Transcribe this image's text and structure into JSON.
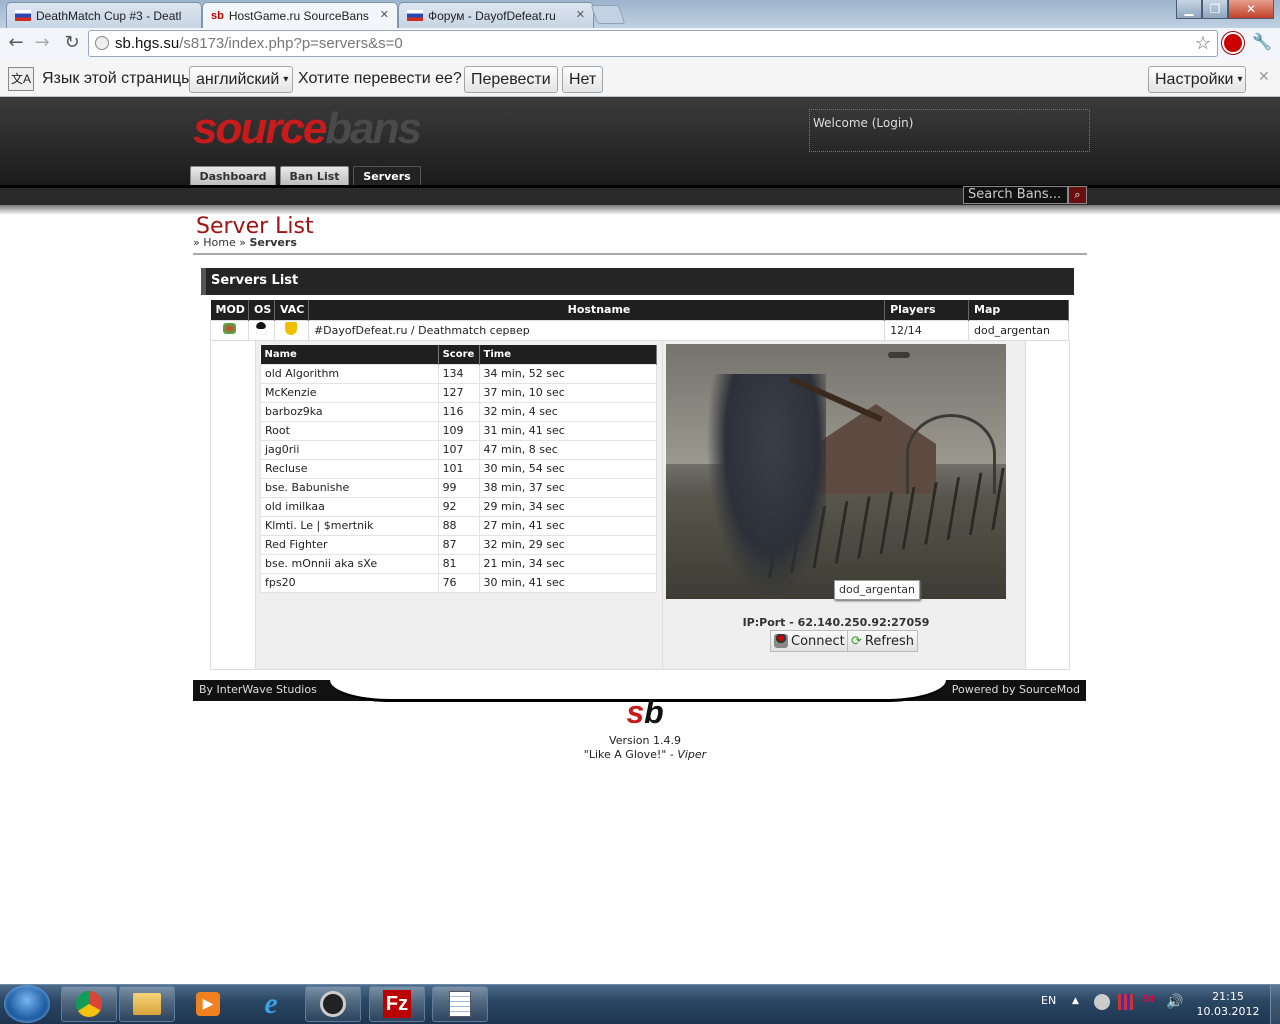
{
  "browser": {
    "tabs": [
      {
        "title": "DeathMatch Cup #3 - Deatl"
      },
      {
        "title": "HostGame.ru SourceBans"
      },
      {
        "title": "Форум - DayofDefeat.ru"
      }
    ],
    "url_host": "sb.hgs.su",
    "url_path": "/s8173/index.php?p=servers&s=0",
    "translate": {
      "prompt": "Язык этой страницы",
      "language": "английский",
      "question": "Хотите перевести ее?",
      "translate_btn": "Перевести",
      "no_btn": "Нет",
      "settings_btn": "Настройки"
    }
  },
  "site": {
    "logo_part1": "source",
    "logo_part2": "bans",
    "welcome_prefix": "Welcome (",
    "login": "Login",
    "welcome_suffix": ")",
    "nav": [
      "Dashboard",
      "Ban List",
      "Servers"
    ],
    "search_placeholder": "Search Bans..."
  },
  "page": {
    "title": "Server List",
    "breadcrumb_sep": "»",
    "breadcrumb_home": "Home",
    "breadcrumb_current": "Servers",
    "box_title": "Servers List"
  },
  "servers": {
    "headers": [
      "MOD",
      "OS",
      "VAC",
      "Hostname",
      "Players",
      "Map"
    ],
    "rows": [
      {
        "hostname": "#DayofDefeat.ru / Deathmatch сервер",
        "players": "12/14",
        "map": "dod_argentan"
      }
    ]
  },
  "players": {
    "headers": [
      "Name",
      "Score",
      "Time"
    ],
    "rows": [
      [
        "old Algorithm",
        "134",
        "34 min, 52 sec"
      ],
      [
        "McKenzie",
        "127",
        "37 min, 10 sec"
      ],
      [
        "barboz9ka",
        "116",
        "32 min, 4 sec"
      ],
      [
        "Root",
        "109",
        "31 min, 41 sec"
      ],
      [
        "jag0rii",
        "107",
        "47 min, 8 sec"
      ],
      [
        "Recluse",
        "101",
        "30 min, 54 sec"
      ],
      [
        "bse. Babunishe",
        "99",
        "38 min, 37 sec"
      ],
      [
        "old imilkaa",
        "92",
        "29 min, 34 sec"
      ],
      [
        "Klmti. Le | $mertnik",
        "88",
        "27 min, 41 sec"
      ],
      [
        "Red Fighter",
        "87",
        "32 min, 29 sec"
      ],
      [
        "bse. mOnnii aka sXe",
        "81",
        "21 min, 34 sec"
      ],
      [
        "fps20",
        "76",
        "30 min, 41 sec"
      ]
    ]
  },
  "map_panel": {
    "map_label": "dod_argentan",
    "ip_port": "IP:Port - 62.140.250.92:27059",
    "connect": "Connect",
    "refresh": "Refresh"
  },
  "footer": {
    "left": "By InterWave Studios",
    "right": "Powered by SourceMod",
    "version": "Version 1.4.9",
    "quote": "\"Like A Glove!\" - ",
    "quote_author": "Viper",
    "logo_s": "s",
    "logo_b": "b"
  },
  "taskbar": {
    "lang": "EN",
    "time": "21:15",
    "date": "10.03.2012",
    "apps": [
      "chrome-icon",
      "explorer-icon",
      "media-player-icon",
      "ie-icon",
      "steam-icon",
      "filezilla-icon",
      "notepad-icon"
    ]
  },
  "colors": {
    "brand_red": "#c81b1b",
    "header_dark": "#1f1f1f"
  }
}
